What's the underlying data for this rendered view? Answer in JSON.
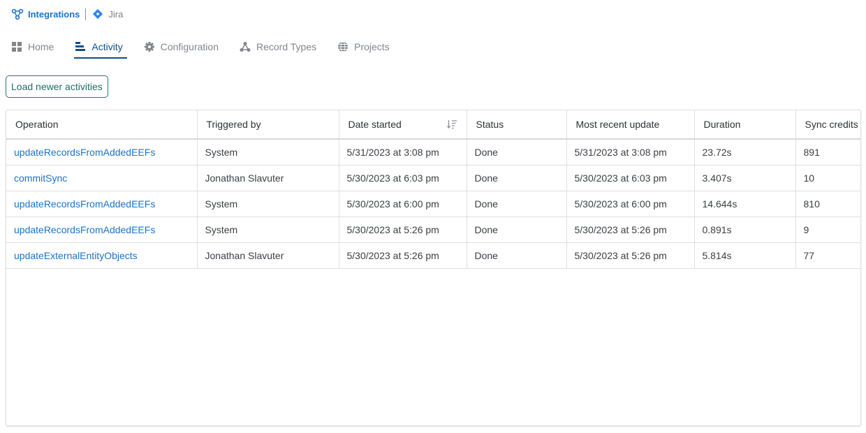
{
  "breadcrumb": {
    "root_label": "Integrations",
    "root_icon": "integrations-icon",
    "current_label": "Jira",
    "current_icon": "jira-icon"
  },
  "tabs": [
    {
      "label": "Home",
      "icon": "grid-icon",
      "active": false
    },
    {
      "label": "Activity",
      "icon": "activity-bars-icon",
      "active": true
    },
    {
      "label": "Configuration",
      "icon": "gear-icon",
      "active": false
    },
    {
      "label": "Record Types",
      "icon": "nodes-icon",
      "active": false
    },
    {
      "label": "Projects",
      "icon": "globe-icon",
      "active": false
    }
  ],
  "load_button_label": "Load newer activities",
  "table": {
    "headers": [
      "Operation",
      "Triggered by",
      "Date started",
      "Status",
      "Most recent update",
      "Duration",
      "Sync credits"
    ],
    "sorted_column": "Date started",
    "rows": [
      [
        "updateRecordsFromAddedEEFs",
        "System",
        "5/31/2023 at 3:08 pm",
        "Done",
        "5/31/2023 at 3:08 pm",
        "23.72s",
        "891"
      ],
      [
        "commitSync",
        "Jonathan Slavuter",
        "5/30/2023 at 6:03 pm",
        "Done",
        "5/30/2023 at 6:03 pm",
        "3.407s",
        "10"
      ],
      [
        "updateRecordsFromAddedEEFs",
        "System",
        "5/30/2023 at 6:00 pm",
        "Done",
        "5/30/2023 at 6:00 pm",
        "14.644s",
        "810"
      ],
      [
        "updateRecordsFromAddedEEFs",
        "System",
        "5/30/2023 at 5:26 pm",
        "Done",
        "5/30/2023 at 5:26 pm",
        "0.891s",
        "9"
      ],
      [
        "updateExternalEntityObjects",
        "Jonathan Slavuter",
        "5/30/2023 at 5:26 pm",
        "Done",
        "5/30/2023 at 5:26 pm",
        "5.814s",
        "77"
      ]
    ]
  },
  "colors": {
    "link": "#1a73c8",
    "active_tab": "#0d4f85",
    "button_border": "#1d7a72",
    "jira": "#2684ff"
  }
}
